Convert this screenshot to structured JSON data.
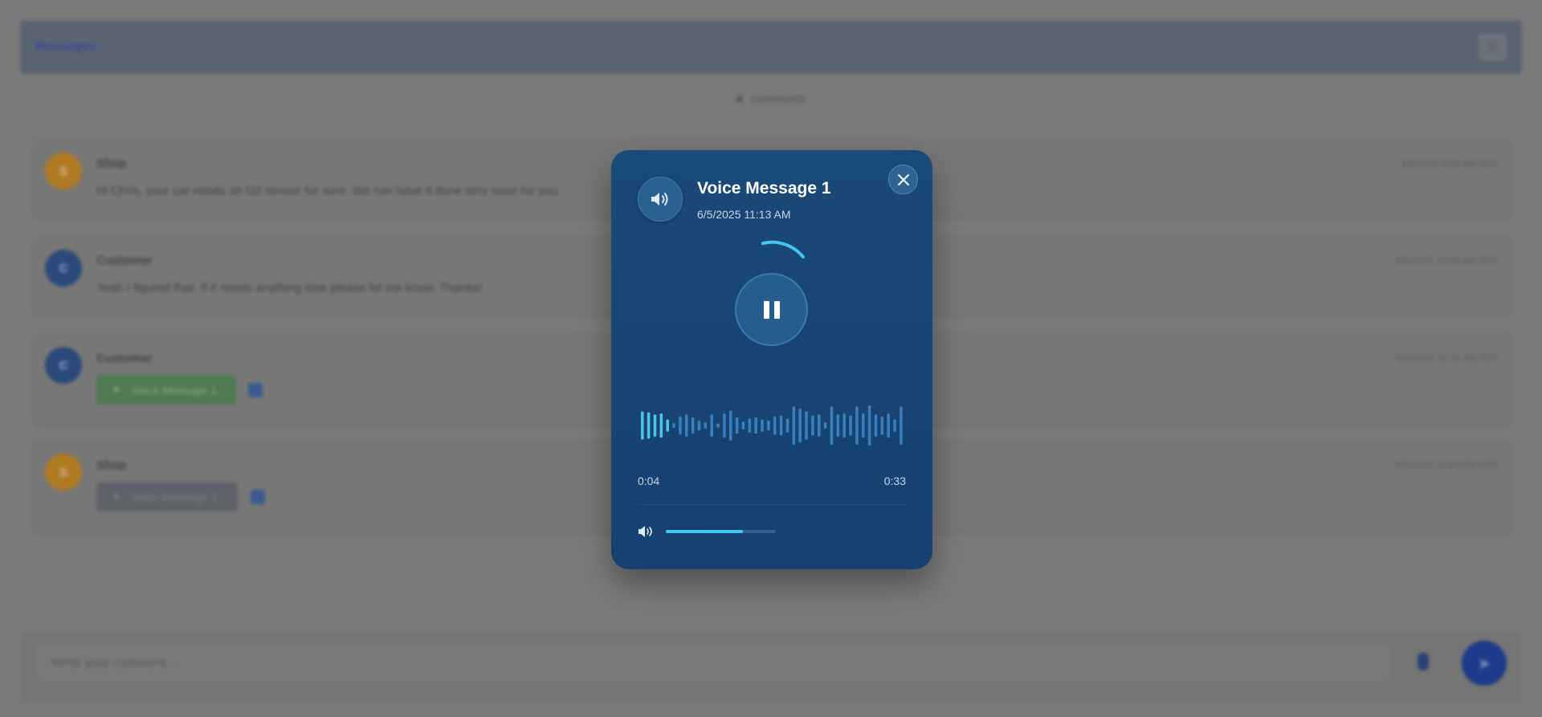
{
  "header": {
    "title": "Messages",
    "menu_icon": "list-icon"
  },
  "comments_bar": {
    "count": "4",
    "label": "comments"
  },
  "comments": [
    {
      "author": "Shop",
      "avatar": "S",
      "role": "shop",
      "text": "Hi Chris, your car needs an O2 sensor for sure. We can have it done very soon for you.",
      "timestamp": "6/5/2025 9:00 AM PDT"
    },
    {
      "author": "Customer",
      "avatar": "C",
      "role": "customer",
      "text": "Yeah I figured that. If it needs anything else please let me know. Thanks!",
      "timestamp": "6/5/2025 10:00 AM PDT"
    },
    {
      "author": "Customer",
      "avatar": "C",
      "role": "customer",
      "voice_label": "Voice Message 1",
      "timestamp": "6/5/2025 11:13 AM PDT"
    },
    {
      "author": "Shop",
      "avatar": "S",
      "role": "shop",
      "voice_label": "Voice Message 2",
      "timestamp": "6/5/2025 12:00 PM PDT"
    }
  ],
  "composer": {
    "placeholder": "Write your comment..."
  },
  "player": {
    "title": "Voice Message 1",
    "date": "6/5/2025 11:13 AM",
    "current_time": "0:04",
    "duration": "0:33",
    "progress": 0.12,
    "volume": 0.7,
    "state": "playing",
    "waveform": [
      0.7,
      0.65,
      0.55,
      0.6,
      0.3,
      0.12,
      0.45,
      0.55,
      0.4,
      0.25,
      0.15,
      0.55,
      0.1,
      0.6,
      0.75,
      0.4,
      0.2,
      0.35,
      0.4,
      0.3,
      0.25,
      0.45,
      0.5,
      0.35,
      0.95,
      0.85,
      0.7,
      0.5,
      0.55,
      0.15,
      0.95,
      0.55,
      0.6,
      0.5,
      0.95,
      0.6,
      1.0,
      0.55,
      0.45,
      0.6,
      0.3,
      0.95
    ],
    "colors": {
      "accent": "#45c6ee",
      "played": "#4fc3ea",
      "unplayed": "#3a7fbf",
      "background": "#1a4a78"
    }
  }
}
